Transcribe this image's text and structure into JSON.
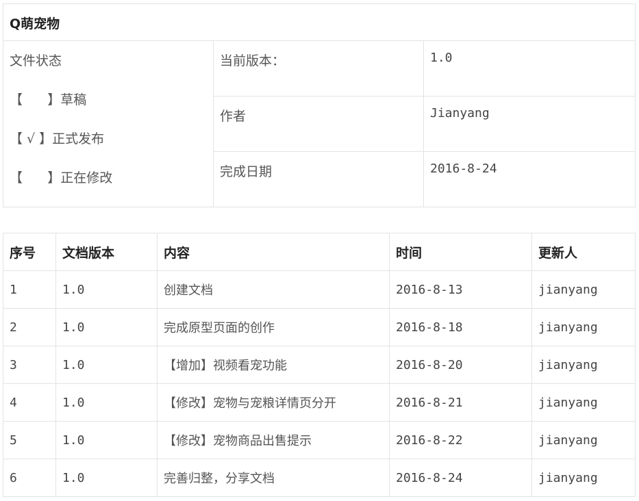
{
  "doc": {
    "title": "Q萌宠物",
    "status": {
      "heading": "文件状态",
      "options": [
        "【      】草稿",
        "【 √ 】正式发布",
        "【      】正在修改"
      ]
    },
    "info": [
      {
        "label": "当前版本：",
        "value": "1.0"
      },
      {
        "label": "作者",
        "value": "Jianyang"
      },
      {
        "label": "完成日期",
        "value": "2016-8-24"
      }
    ]
  },
  "history": {
    "headers": [
      "序号",
      "文档版本",
      "内容",
      "时间",
      "更新人"
    ],
    "rows": [
      {
        "no": "1",
        "version": "1.0",
        "content": "创建文档",
        "date": "2016-8-13",
        "updater": "jianyang"
      },
      {
        "no": "2",
        "version": "1.0",
        "content": "完成原型页面的创作",
        "date": "2016-8-18",
        "updater": "jianyang"
      },
      {
        "no": "3",
        "version": "1.0",
        "content": "【增加】视频看宠功能",
        "date": "2016-8-20",
        "updater": "jianyang"
      },
      {
        "no": "4",
        "version": "1.0",
        "content": "【修改】宠物与宠粮详情页分开",
        "date": "2016-8-21",
        "updater": "jianyang"
      },
      {
        "no": "5",
        "version": "1.0",
        "content": "【修改】宠物商品出售提示",
        "date": "2016-8-22",
        "updater": "jianyang"
      },
      {
        "no": "6",
        "version": "1.0",
        "content": "完善归整，分享文档",
        "date": "2016-8-24",
        "updater": "jianyang"
      }
    ]
  }
}
